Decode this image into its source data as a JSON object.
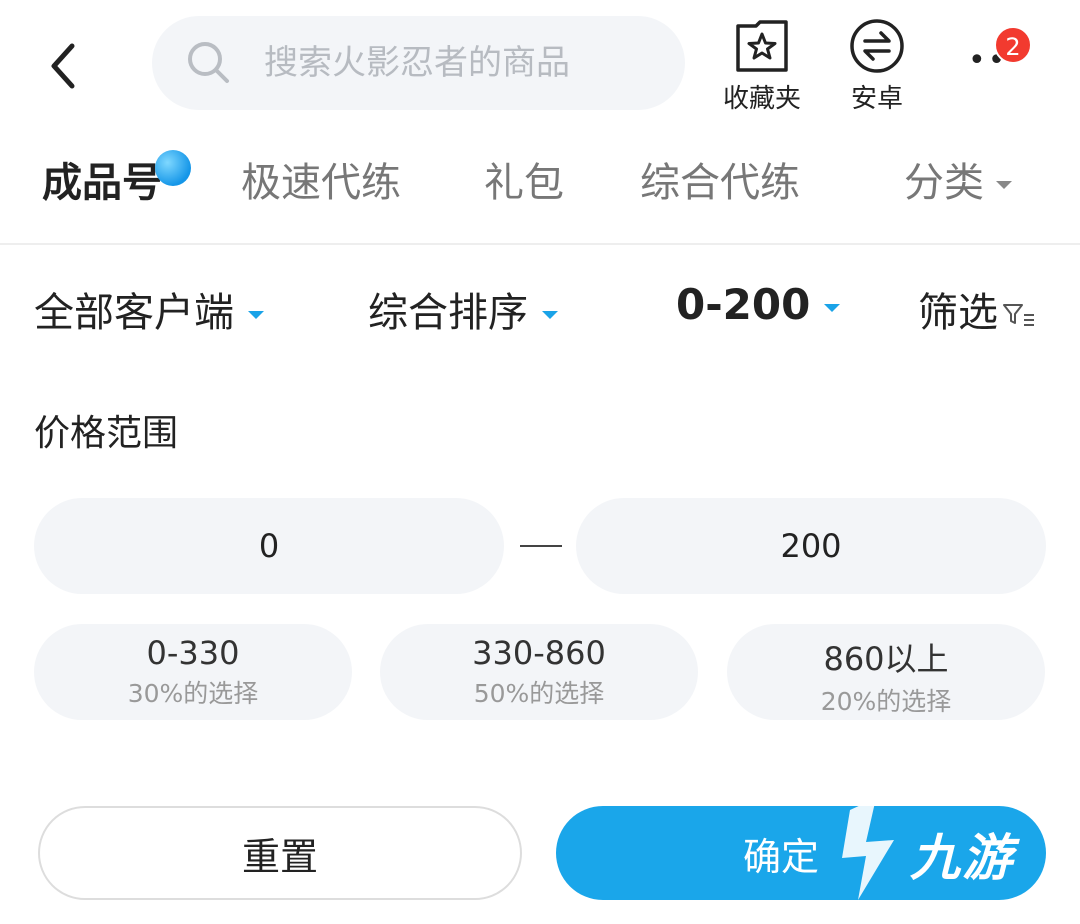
{
  "header": {
    "search_placeholder": "搜索火影忍者的商品",
    "favorites_label": "收藏夹",
    "android_label": "安卓",
    "notification_count": "2"
  },
  "tabs": [
    {
      "label": "成品号",
      "active": true
    },
    {
      "label": "极速代练"
    },
    {
      "label": "礼包"
    },
    {
      "label": "综合代练"
    },
    {
      "label": "分类"
    }
  ],
  "filters": {
    "client": "全部客户端",
    "sort": "综合排序",
    "price": "0-200",
    "filter": "筛选"
  },
  "price_section": {
    "title": "价格范围",
    "min_value": "0",
    "max_value": "200",
    "ranges": [
      {
        "range": "0-330",
        "pct": "30%的选择"
      },
      {
        "range": "330-860",
        "pct": "50%的选择"
      },
      {
        "range": "860以上",
        "pct": "20%的选择"
      }
    ]
  },
  "buttons": {
    "reset": "重置",
    "confirm": "确定"
  },
  "watermark": "九游",
  "colors": {
    "accent": "#1aa6ea",
    "badge": "#f23a2f",
    "input_bg": "#f3f5f8"
  }
}
